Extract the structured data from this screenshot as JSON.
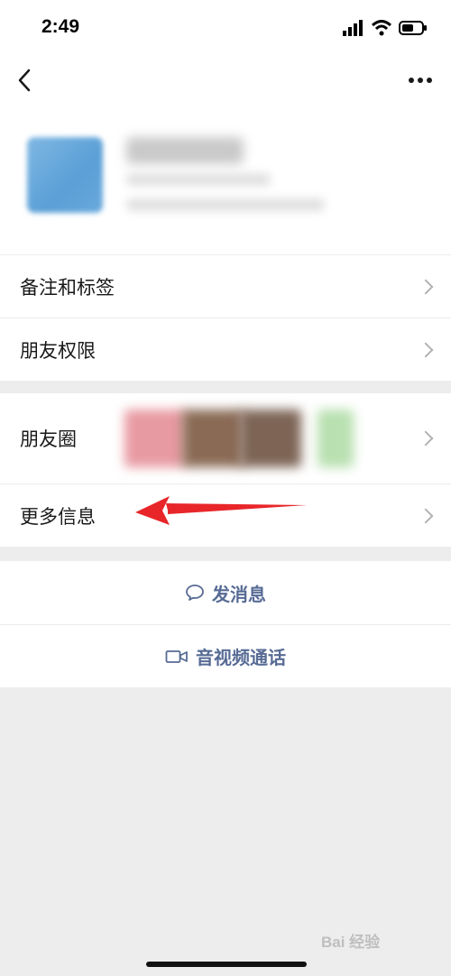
{
  "status_bar": {
    "time": "2:49"
  },
  "nav": {
    "back_icon": "chevron-left-icon",
    "more_icon": "ellipsis-icon"
  },
  "settings_rows": [
    {
      "label": "备注和标签"
    },
    {
      "label": "朋友权限"
    }
  ],
  "info_rows": {
    "moments": "朋友圈",
    "more_info": "更多信息"
  },
  "actions": {
    "message": "发消息",
    "call": "音视频通话"
  },
  "watermark": "Bai 经验",
  "colors": {
    "accent": "#576b95",
    "annotation_arrow": "#e8262a",
    "background": "#ededed"
  }
}
